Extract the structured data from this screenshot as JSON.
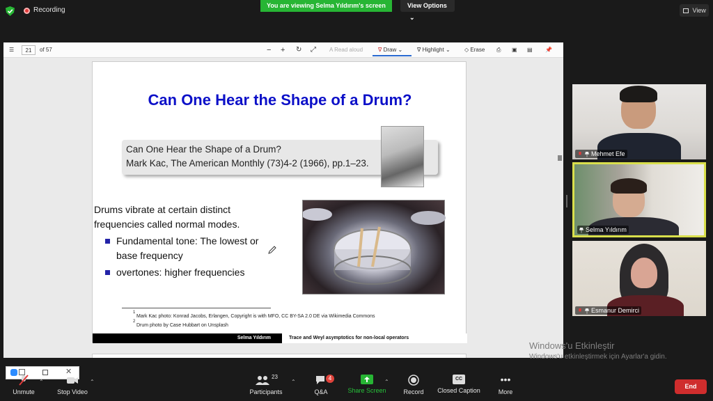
{
  "top_bar": {
    "recording_label": "Recording",
    "viewing_banner": "You are viewing Selma Yıldırım's screen",
    "view_options_label": "View Options",
    "view_button_label": "View"
  },
  "pdf_toolbar": {
    "page_number": "21",
    "page_count": "of 57",
    "read_aloud": "Read aloud",
    "draw": "Draw",
    "highlight": "Highlight",
    "erase": "Erase"
  },
  "slide": {
    "title": "Can One Hear the Shape of a Drum?",
    "reference_line1": "Can One Hear the Shape of a Drum?",
    "reference_line2": "Mark Kac, The American Monthly (73)4-2 (1966), pp.1–23.",
    "intro_line1": "Drums vibrate at certain distinct",
    "intro_line2": "frequencies called normal modes.",
    "bullet1_line1": "Fundamental tone: The lowest or",
    "bullet1_line2": "base frequency",
    "bullet2": "overtones: higher frequencies",
    "footnote1_mark": "1",
    "footnote1": "Mark Kac photo: Konrad Jacobs, Erlangen, Copyright is with MFO, CC BY-SA 2.0 DE via Wikimedia Commons",
    "footnote2_mark": "2",
    "footnote2": "Drum photo by Case Hubbart on Unsplash",
    "footer_name": "Selma Yıldırım",
    "footer_topic": "Trace and Weyl asymptotics for non-local operators"
  },
  "participants_tiles": [
    {
      "name": "Mehmet Efe",
      "muted": true
    },
    {
      "name": "Selma Yıldırım",
      "muted": false
    },
    {
      "name": "Esmanur Demirci",
      "muted": true
    }
  ],
  "watermark": {
    "line1": "Windows'u Etkinleştir",
    "line2": "Windows'u etkinleştirmek için Ayarlar'a gidin."
  },
  "bottom_bar": {
    "unmute": "Unmute",
    "stop_video": "Stop Video",
    "participants": "Participants",
    "participants_count": "23",
    "qa": "Q&A",
    "qa_badge": "4",
    "share_screen": "Share Screen",
    "record": "Record",
    "closed_caption": "Closed Caption",
    "more": "More",
    "end": "End"
  },
  "colors": {
    "accent_green": "#27b534",
    "slide_title_blue": "#0c10c8",
    "end_red": "#cf2d2d",
    "active_speaker_border": "#d9df4c"
  }
}
